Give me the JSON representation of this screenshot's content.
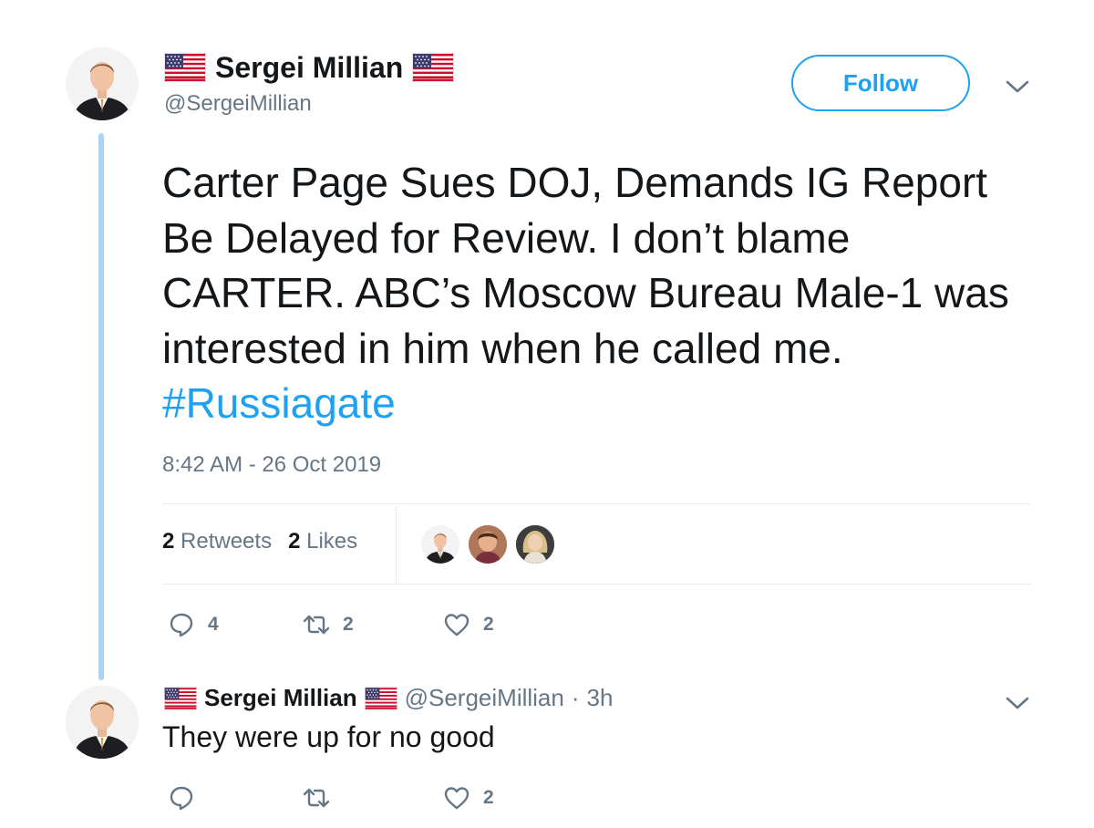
{
  "tweet": {
    "author_name": "Sergei Millian",
    "author_handle": "@SergeiMillian",
    "follow_label": "Follow",
    "text_main": "Carter Page Sues DOJ, Demands IG Report Be Delayed for Review. I don’t blame CARTER. ABC’s Moscow Bureau Male-1 was interested in him when he called me. ",
    "hashtag": "#Russiagate",
    "timestamp": "8:42 AM - 26 Oct 2019",
    "retweets_count": "2",
    "retweets_label": "Retweets",
    "likes_count": "2",
    "likes_label": "Likes",
    "actions": {
      "reply_count": "4",
      "retweet_count": "2",
      "like_count": "2"
    }
  },
  "reply": {
    "author_name": "Sergei Millian",
    "author_handle": "@SergeiMillian",
    "separator": "·",
    "time": "3h",
    "text": "They were up for no good",
    "actions": {
      "reply_count": "",
      "retweet_count": "",
      "like_count": "2"
    }
  },
  "colors": {
    "accent": "#1da1f2",
    "muted": "#657786",
    "thread_line": "#a9d4f5"
  },
  "icons": [
    "us-flag-icon",
    "chevron-down-icon",
    "reply-icon",
    "retweet-icon",
    "heart-icon"
  ]
}
